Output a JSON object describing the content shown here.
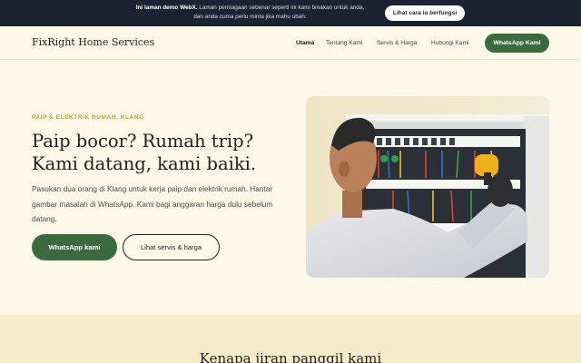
{
  "banner": {
    "strong": "Ini laman demo WebX.",
    "text_line1": " Laman perniagaan sebenar seperti ini kami binakan untuk anda,",
    "text_line2": "dan anda cuma perlu minta jika mahu ubah.",
    "button_label": "Lihat cara ia berfungsi"
  },
  "nav": {
    "brand": "FixRight Home Services",
    "links": [
      "Utama",
      "Tentang Kami",
      "Servis & Harga",
      "Hubungi Kami"
    ],
    "cta_label": "WhatsApp Kami"
  },
  "hero": {
    "eyebrow": "PAIP & ELEKTRIK RUMAH, KLANG",
    "title_line1": "Paip bocor? Rumah trip?",
    "title_line2": "Kami datang, kami baiki.",
    "lead": "Pasukan dua orang di Klang untuk kerja paip dan elektrik rumah. Hantar gambar masalah di WhatsApp. Kami bagi anggaran harga dulu sebelum datang.",
    "primary_label": "WhatsApp kami",
    "secondary_label": "Lihat servis & harga"
  },
  "section2": {
    "title": "Kenapa jiran panggil kami"
  },
  "colors": {
    "accent_green": "#3a6b3e",
    "eyebrow_amber": "#d49a3b",
    "banner_bg": "#1b2332",
    "page_bg": "#fdf8e7"
  }
}
